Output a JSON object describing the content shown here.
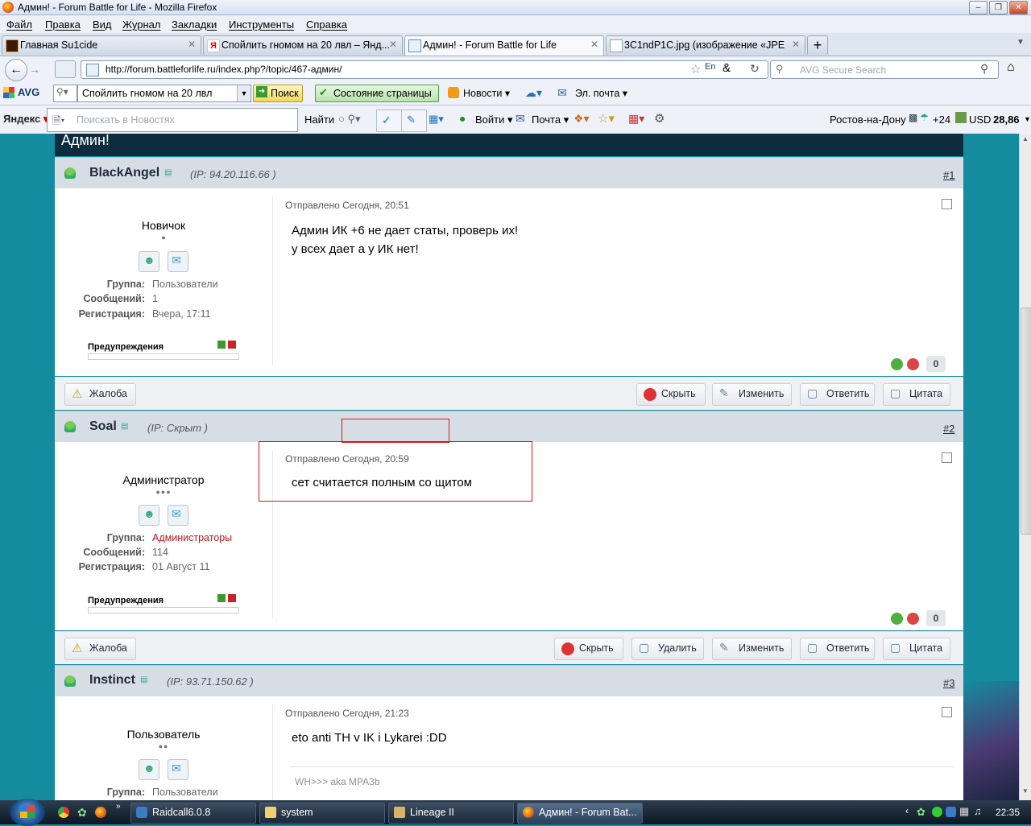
{
  "window": {
    "title": "Админ! - Forum Battle for Life - Mozilla Firefox"
  },
  "menu": [
    "Файл",
    "Правка",
    "Вид",
    "Журнал",
    "Закладки",
    "Инструменты",
    "Справка"
  ],
  "tabs": [
    {
      "label": "Главная Su1cide"
    },
    {
      "label": "Спойлить гномом на 20 лвл – Янд..."
    },
    {
      "label": "Админ! - Forum Battle for Life"
    },
    {
      "label": "3C1ndP1C.jpg (изображение «JPE..."
    }
  ],
  "nav": {
    "url": "http://forum.battleforlife.ru/index.php?/topic/467-админ/",
    "search_placeholder": "AVG Secure Search"
  },
  "avg": {
    "brand": "AVG",
    "query": "Спойлить гномом на 20 лвл",
    "search_btn": "Поиск",
    "page_status": "Состояние страницы",
    "news": "Новости",
    "mail": "Эл. почта"
  },
  "yandex": {
    "brand": "Яндекс",
    "search_placeholder": "Поискать в Новостях",
    "find": "Найти",
    "login": "Войти",
    "mail": "Почта",
    "city": "Ростов-на-Дону",
    "temp": "+24",
    "currency_label": "USD",
    "currency_value": "28,86"
  },
  "topic": {
    "title": "Админ!"
  },
  "posts": [
    {
      "author": "BlackAngel",
      "ip": "(IP: 94.20.116.66 )",
      "num": "#1",
      "sent": "Отправлено Сегодня, 20:51",
      "rank": "Новичок",
      "rank_dots": "●",
      "group_label": "Группа:",
      "group": "Пользователи",
      "posts_label": "Сообщений:",
      "posts_count": "1",
      "reg_label": "Регистрация:",
      "reg": "Вчера, 17:11",
      "warn_label": "Предупреждения",
      "text1": "Админ ИК +6 не дает статы, проверь их!",
      "text2": "у всех дает а у ИК нет!",
      "rep": "0"
    },
    {
      "author": "Soal",
      "ip": "(IP: Скрыт )",
      "num": "#2",
      "sent_prefix": "Отправлено ",
      "sent_time": "Сегодня, 20:59",
      "rank": "Администратор",
      "rank_dots": "●●●",
      "group_label": "Группа:",
      "group": "Администраторы",
      "posts_label": "Сообщений:",
      "posts_count": "114",
      "reg_label": "Регистрация:",
      "reg": "01 Август 11",
      "warn_label": "Предупреждения",
      "text1": "сет считается полным со щитом",
      "rep": "0"
    },
    {
      "author": "Instinct",
      "ip": "(IP: 93.71.150.62 )",
      "num": "#3",
      "sent": "Отправлено Сегодня, 21:23",
      "rank": "Пользователь",
      "rank_dots": "●●",
      "group_label": "Группа:",
      "group": "Пользователи",
      "text1": "eto anti TH v IK i Lykarei :DD",
      "signature": "WH>>> aka MPA3b"
    }
  ],
  "buttons": {
    "report": "Жалоба",
    "hide": "Скрыть",
    "delete": "Удалить",
    "edit": "Изменить",
    "reply": "Ответить",
    "quote": "Цитата"
  },
  "taskbar": {
    "items": [
      "Raidcall6.0.8",
      "system",
      "Lineage II",
      "Админ! - Forum Bat..."
    ],
    "clock": "22:35"
  },
  "colors": {
    "admin_group": "#c0161a",
    "page_bg": "#158ba0",
    "header_dark": "#0d2d3e"
  }
}
